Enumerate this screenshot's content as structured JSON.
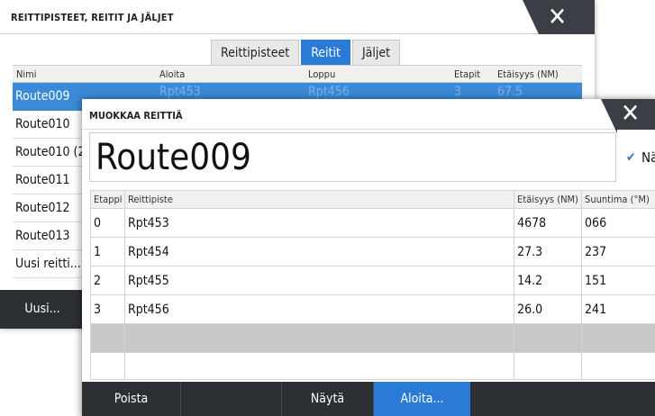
{
  "back_dialog": {
    "title": "REITTIPISTEET, REITIT JA JÄLJET",
    "tabs": [
      {
        "label": "Reittipisteet",
        "active": false
      },
      {
        "label": "Reitit",
        "active": true
      },
      {
        "label": "Jäljet",
        "active": false
      }
    ],
    "columns": [
      "Nimi",
      "Aloita",
      "Loppu",
      "Etapit",
      "Etäisyys (NM)"
    ],
    "selected_row_partial": {
      "start": "Rpt453",
      "end": "Rpt456",
      "legs": "3",
      "distance": "67.5"
    },
    "routes": [
      "Route009",
      "Route010",
      "Route010 (2",
      "Route011",
      "Route012",
      "Route013",
      "Uusi reitti..."
    ],
    "footer_button": "Uusi..."
  },
  "front_dialog": {
    "title": "MUOKKAA REITTIÄ",
    "route_name": "Route009",
    "show_checkbox": {
      "label": "Näytä",
      "checked": true
    },
    "columns": [
      "Etappi",
      "Reittipiste",
      "Etäisyys (NM)",
      "Suuntima (°M)"
    ],
    "legs": [
      {
        "leg": "0",
        "waypoint": "Rpt453",
        "distance": "4678",
        "bearing": "066"
      },
      {
        "leg": "1",
        "waypoint": "Rpt454",
        "distance": "27.3",
        "bearing": "237"
      },
      {
        "leg": "2",
        "waypoint": "Rpt455",
        "distance": "14.2",
        "bearing": "151"
      },
      {
        "leg": "3",
        "waypoint": "Rpt456",
        "distance": "26.0",
        "bearing": "241"
      }
    ],
    "footer": {
      "delete": "Poista",
      "show": "Näytä",
      "start": "Aloita..."
    }
  },
  "icons": {
    "close": "close-icon",
    "check": "check-icon"
  },
  "colors": {
    "accent": "#2b7bd6",
    "selected_row": "#3a8ad8",
    "footer": "#2c2f33",
    "delete_red": "#d6252c"
  }
}
